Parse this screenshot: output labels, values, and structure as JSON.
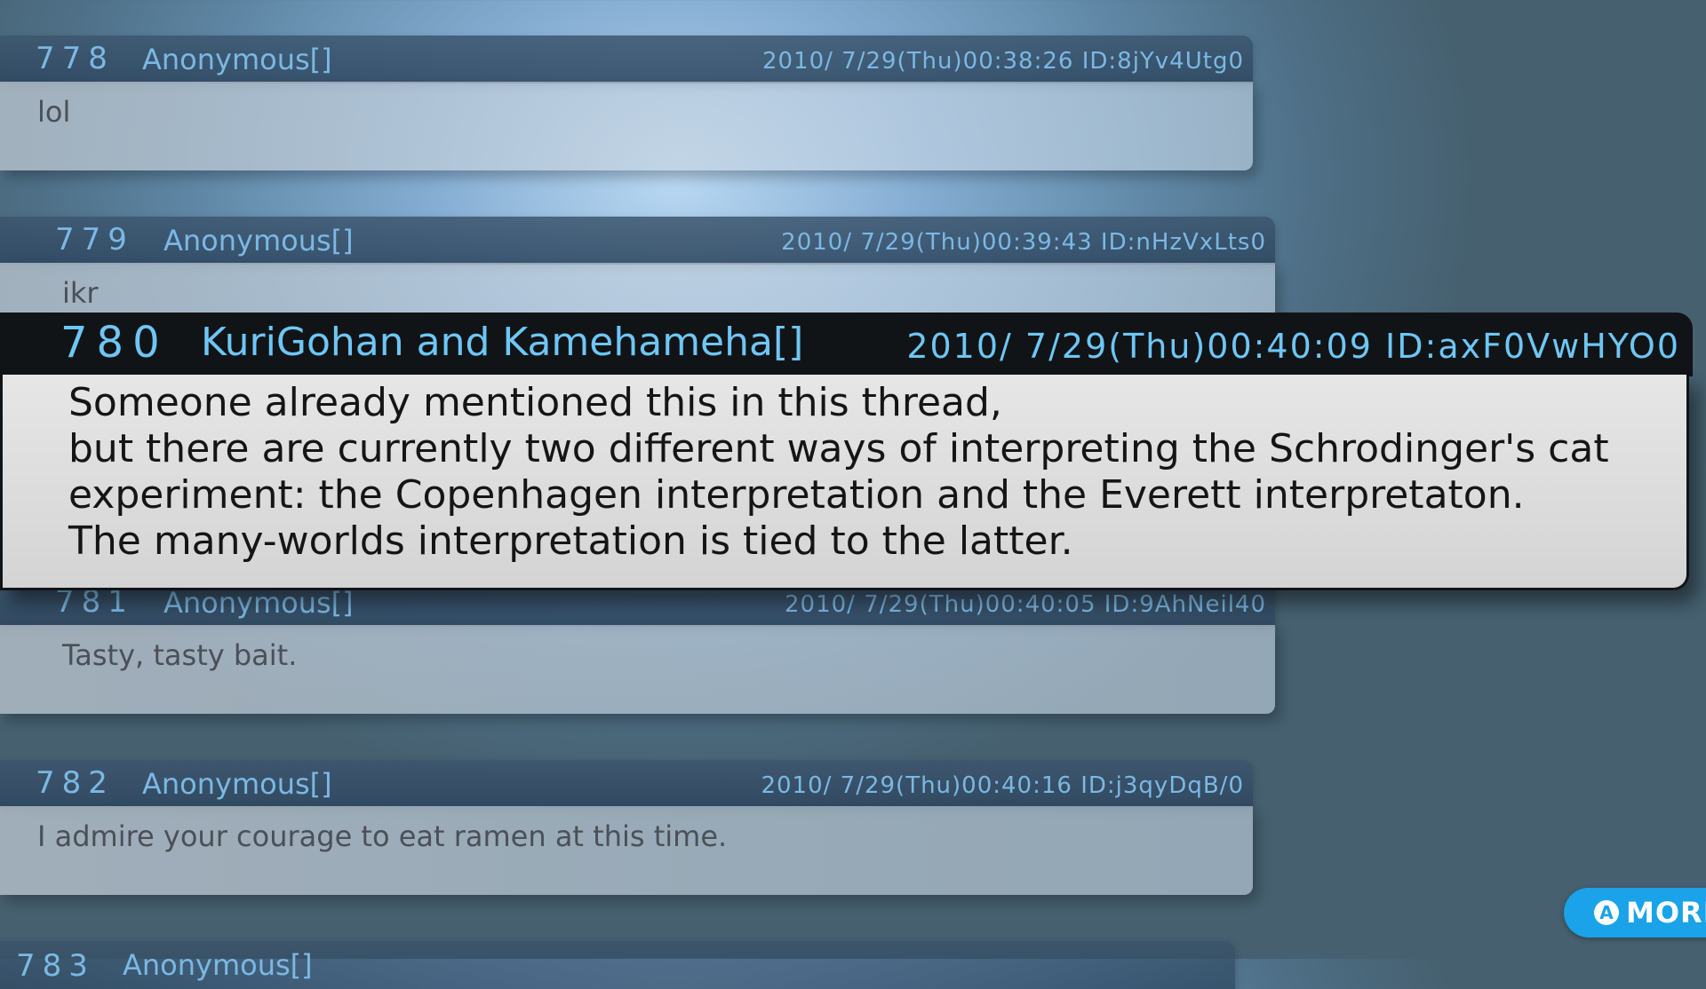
{
  "posts": [
    {
      "number": "778",
      "name": "Anonymous[]",
      "datetime": "2010/ 7/29(Thu)00:38:26",
      "id": "ID:8jYv4Utg0",
      "text": "lol"
    },
    {
      "number": "779",
      "name": "Anonymous[]",
      "datetime": "2010/ 7/29(Thu)00:39:43",
      "id": "ID:nHzVxLts0",
      "text": "ikr"
    },
    {
      "number": "781",
      "name": "Anonymous[]",
      "datetime": "2010/ 7/29(Thu)00:40:05",
      "id": "ID:9AhNeil40",
      "text": "Tasty, tasty bait."
    },
    {
      "number": "782",
      "name": "Anonymous[]",
      "datetime": "2010/ 7/29(Thu)00:40:16",
      "id": "ID:j3qyDqB/0",
      "text": "I admire your courage to eat ramen at this time."
    },
    {
      "number": "783",
      "name": "Anonymous[]",
      "datetime": "",
      "id": "",
      "text": ""
    }
  ],
  "highlighted": {
    "number": "780",
    "name": "KuriGohan and Kamehameha[]",
    "datetime": "2010/ 7/29(Thu)00:40:09",
    "id": "ID:axF0VwHYO0",
    "lines": [
      "Someone already mentioned this in this thread,",
      "but there are currently two different ways of interpreting the Schrodinger's cat",
      "experiment: the Copenhagen interpretation and the Everett interpretaton.",
      "The many-worlds interpretation is tied to the latter."
    ]
  },
  "more_button": {
    "label": "MORE",
    "button_glyph": "A"
  },
  "colors": {
    "accent": "#6ec6f5",
    "more_button": "#1aa3e8",
    "highlight_header": "#111417"
  }
}
